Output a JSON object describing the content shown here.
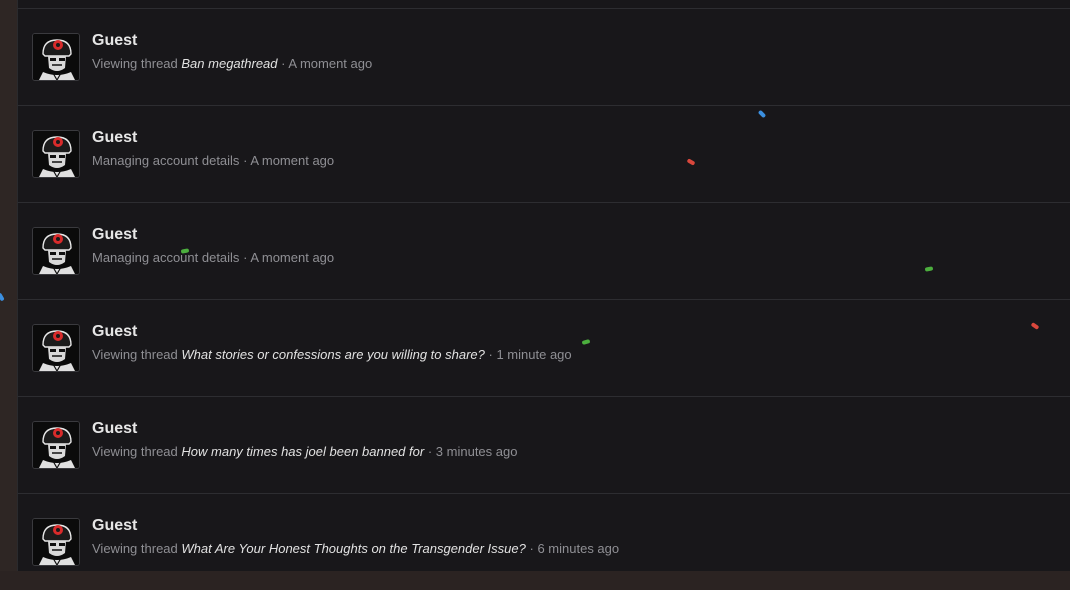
{
  "rows": [
    {
      "name": "Guest",
      "prefix": "Viewing thread",
      "thread": "Ban megathread",
      "time": "A moment ago"
    },
    {
      "name": "Guest",
      "prefix": "Managing account details",
      "thread": "",
      "time": "A moment ago"
    },
    {
      "name": "Guest",
      "prefix": "Managing account details",
      "thread": "",
      "time": "A moment ago"
    },
    {
      "name": "Guest",
      "prefix": "Viewing thread",
      "thread": "What stories or confessions are you willing to share?",
      "time": "1 minute ago"
    },
    {
      "name": "Guest",
      "prefix": "Viewing thread",
      "thread": "How many times has joel been banned for",
      "time": "3 minutes ago"
    },
    {
      "name": "Guest",
      "prefix": "Viewing thread",
      "thread": "What Are Your Honest Thoughts on the Transgender Issue?",
      "time": "6 minutes ago"
    }
  ],
  "separator": "·",
  "colors": {
    "panel_bg": "#18171a",
    "name_text": "#e6e6e6",
    "muted_text": "#8f8f94",
    "thread_text": "#e2e2e2",
    "confetti": [
      "#3b8fe0",
      "#d9473c",
      "#4caf3e"
    ]
  },
  "icons": {
    "avatar": "soldier-skull-avatar-icon"
  }
}
